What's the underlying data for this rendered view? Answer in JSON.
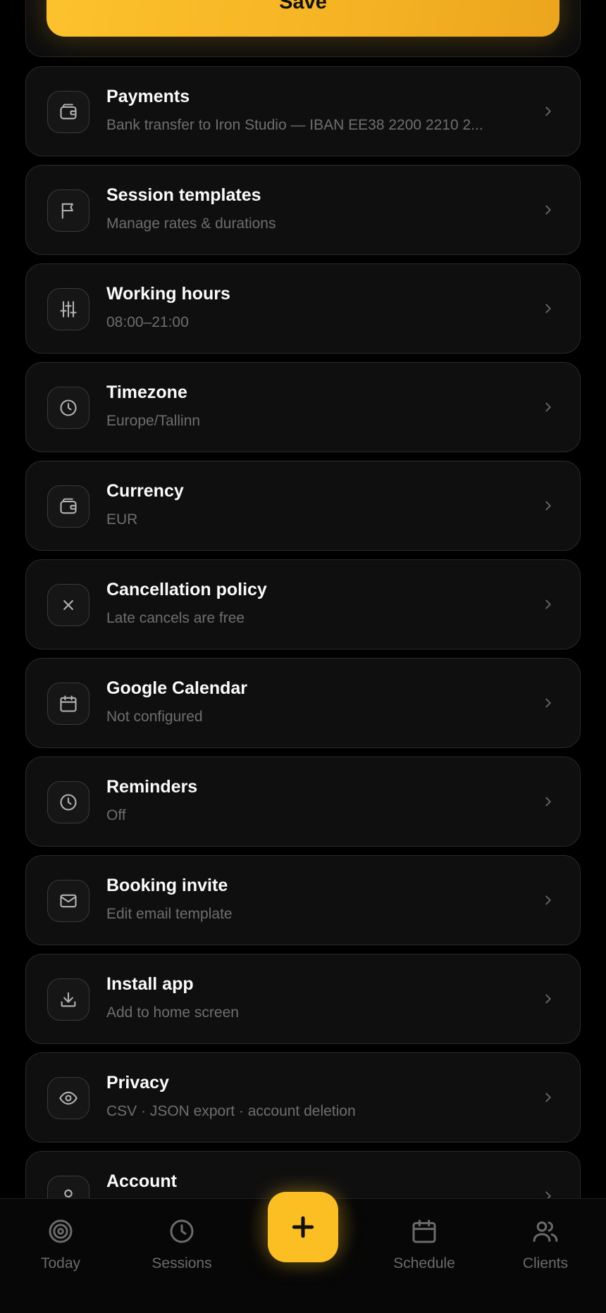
{
  "save_label": "Save",
  "settings": [
    {
      "icon": "wallet-icon",
      "title": "Payments",
      "subtitle": "Bank transfer to Iron Studio — IBAN EE38 2200 2210 2..."
    },
    {
      "icon": "flag-icon",
      "title": "Session templates",
      "subtitle": "Manage rates & durations"
    },
    {
      "icon": "sliders-icon",
      "title": "Working hours",
      "subtitle": "08:00–21:00"
    },
    {
      "icon": "clock-icon",
      "title": "Timezone",
      "subtitle": "Europe/Tallinn"
    },
    {
      "icon": "wallet-icon",
      "title": "Currency",
      "subtitle": "EUR"
    },
    {
      "icon": "close-icon",
      "title": "Cancellation policy",
      "subtitle": "Late cancels are free"
    },
    {
      "icon": "calendar-icon",
      "title": "Google Calendar",
      "subtitle": "Not configured"
    },
    {
      "icon": "clock-icon",
      "title": "Reminders",
      "subtitle": "Off"
    },
    {
      "icon": "mail-icon",
      "title": "Booking invite",
      "subtitle": "Edit email template"
    },
    {
      "icon": "download-icon",
      "title": "Install app",
      "subtitle": "Add to home screen"
    },
    {
      "icon": "eye-icon",
      "title": "Privacy",
      "subtitle": "CSV · JSON export · account deletion"
    },
    {
      "icon": "user-icon",
      "title": "Account",
      "subtitle": ""
    }
  ],
  "nav": {
    "today": "Today",
    "sessions": "Sessions",
    "schedule": "Schedule",
    "clients": "Clients",
    "add_icon": "plus-icon"
  },
  "colors": {
    "accent": "#fbbf24",
    "background": "#000000",
    "card": "#0f0f0f",
    "muted_text": "#6e6e6e"
  }
}
